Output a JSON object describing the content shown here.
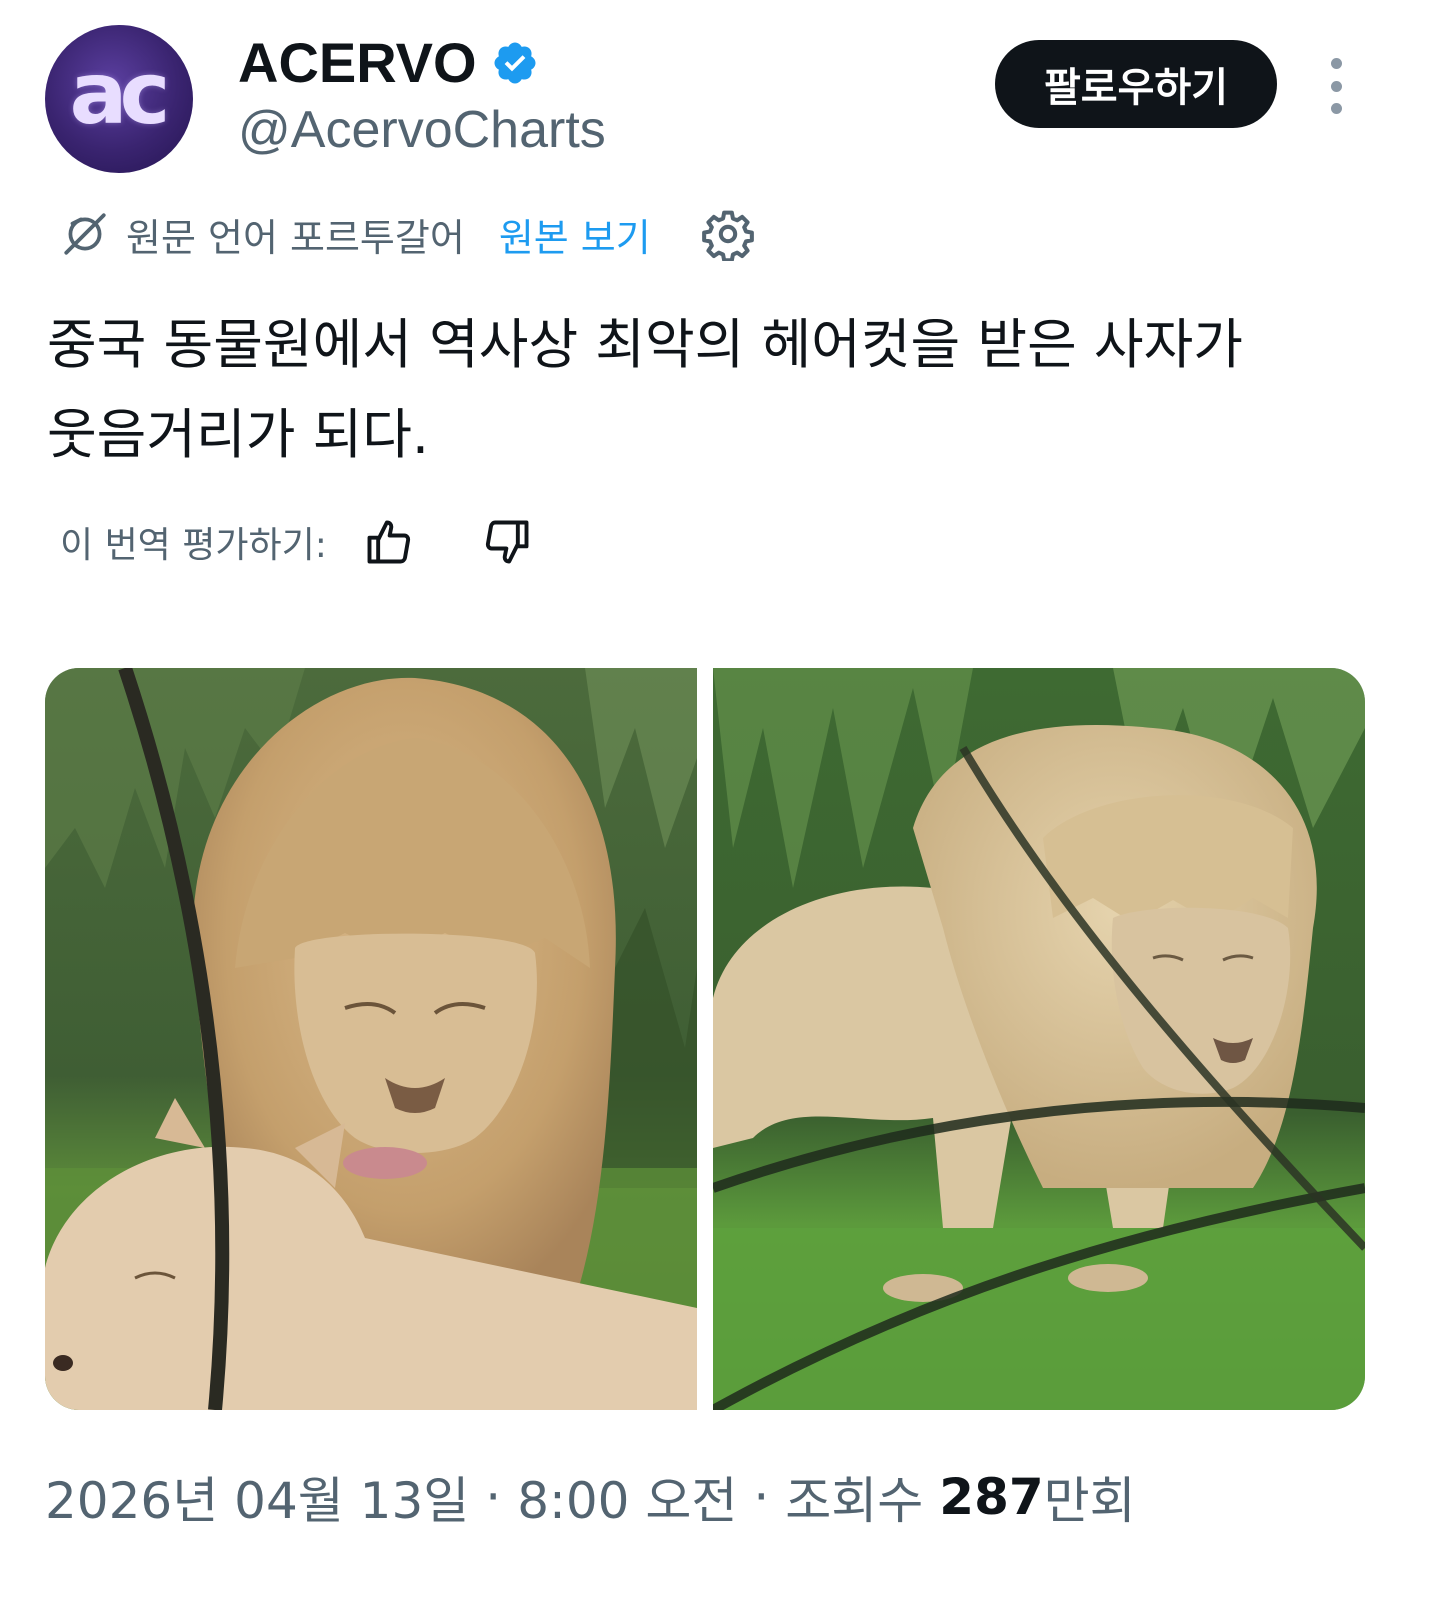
{
  "author": {
    "avatar_text": "ac",
    "display_name": "ACERVO",
    "handle": "@AcervoCharts",
    "verified": true,
    "verified_icon": "verified-badge-icon",
    "verified_color": "#1d9bf0"
  },
  "follow_button": {
    "label": "팔로우하기"
  },
  "more_menu": {
    "icon": "more-vertical-icon"
  },
  "translation": {
    "icon": "translate-icon",
    "source_label": "원문 언어 포르투갈어",
    "show_original_label": "원본 보기",
    "settings_icon": "gear-icon"
  },
  "tweet": {
    "text_line1": "중국 동물원에서 역사상 최악의 헤어컷을 받은 사자가",
    "text_line2": "웃음거리가 되다."
  },
  "rate_translation": {
    "label": "이 번역 평가하기:",
    "thumbs_up_icon": "thumbs-up-icon",
    "thumbs_down_icon": "thumbs-down-icon"
  },
  "media": {
    "photos": [
      {
        "name": "photo-lion-with-lioness"
      },
      {
        "name": "photo-lion-standing-in-grass"
      }
    ]
  },
  "meta": {
    "date": "2026년 04월 13일",
    "separator": "·",
    "time": "8:00 오전",
    "views_label": "조회수",
    "views_count": "287",
    "views_unit": "만회"
  },
  "colors": {
    "text_primary": "#0f1419",
    "text_secondary": "#536471",
    "link": "#1d9bf0",
    "button_bg": "#0f1419"
  }
}
